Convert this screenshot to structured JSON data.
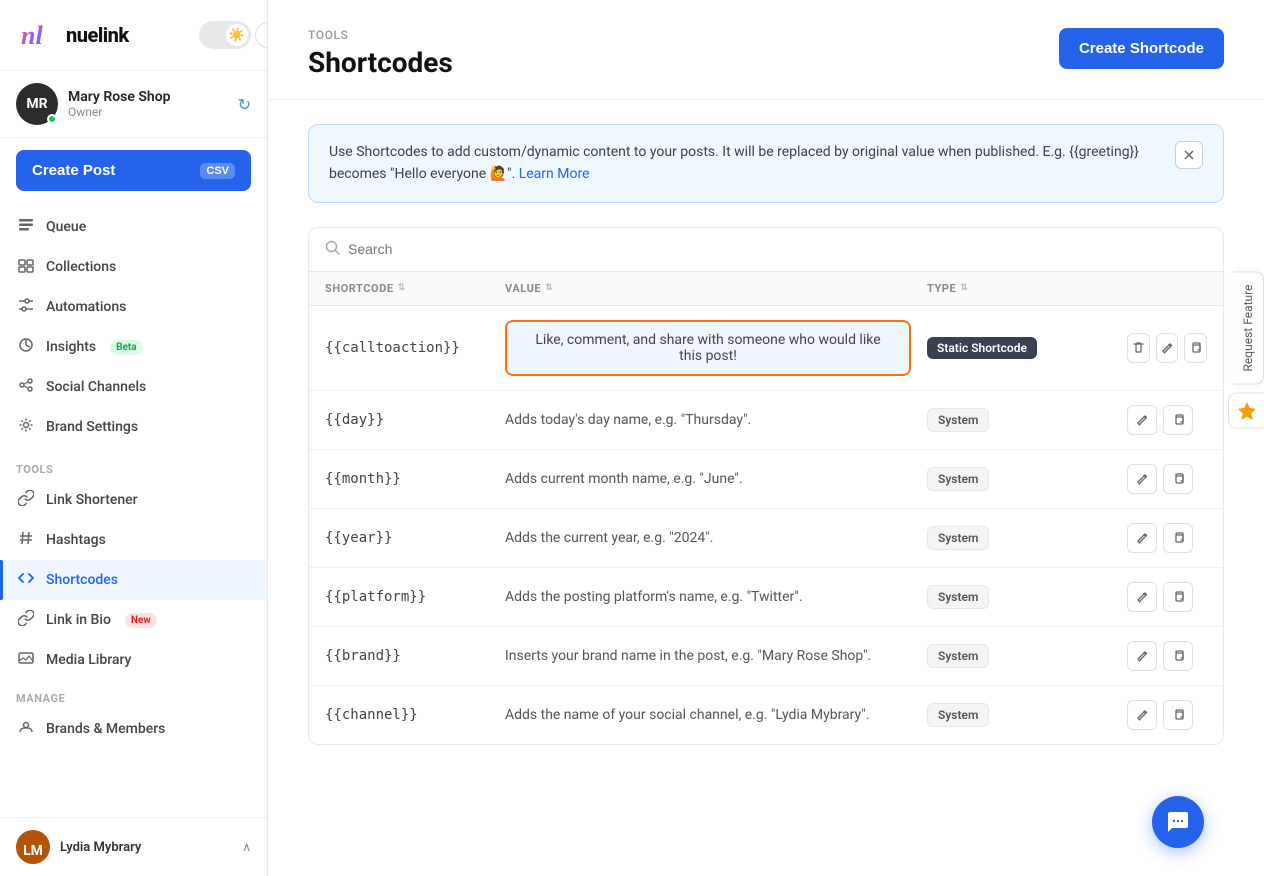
{
  "app": {
    "name": "nuelink",
    "logo_initials": "nl"
  },
  "theme": {
    "icon": "☀️",
    "mode": "light"
  },
  "account": {
    "name": "Mary Rose Shop",
    "role": "Owner",
    "initials": "MR",
    "online": true
  },
  "sidebar": {
    "create_post_label": "Create Post",
    "csv_label": "CSV",
    "nav_items": [
      {
        "id": "queue",
        "label": "Queue",
        "icon": "📅"
      },
      {
        "id": "collections",
        "label": "Collections",
        "icon": "📁"
      },
      {
        "id": "automations",
        "label": "Automations",
        "icon": "✏️"
      },
      {
        "id": "insights",
        "label": "Insights",
        "icon": "🕐",
        "badge": "Beta",
        "badge_type": "beta"
      },
      {
        "id": "social-channels",
        "label": "Social Channels",
        "icon": "🔗"
      },
      {
        "id": "brand-settings",
        "label": "Brand Settings",
        "icon": "⚙️"
      }
    ],
    "tools_label": "TOOLS",
    "tools_items": [
      {
        "id": "link-shortener",
        "label": "Link Shortener",
        "icon": "🔗"
      },
      {
        "id": "hashtags",
        "label": "Hashtags",
        "icon": "#"
      },
      {
        "id": "shortcodes",
        "label": "Shortcodes",
        "icon": "{}",
        "active": true
      },
      {
        "id": "link-in-bio",
        "label": "Link in Bio",
        "icon": "🔗",
        "badge": "New",
        "badge_type": "new"
      },
      {
        "id": "media-library",
        "label": "Media Library",
        "icon": "🖼️"
      }
    ],
    "manage_label": "MANAGE",
    "manage_items": [
      {
        "id": "brands-members",
        "label": "Brands & Members",
        "icon": "👥"
      }
    ],
    "footer_user": "Lydia Mybrary"
  },
  "page": {
    "section_label": "TOOLS",
    "title": "Shortcodes",
    "create_button_label": "Create Shortcode"
  },
  "info_banner": {
    "text": "Use Shortcodes to add custom/dynamic content to your posts. It will be replaced by original value when published. E.g. {{greeting}} becomes \"Hello everyone 🙋\". ",
    "learn_more_label": "Learn More",
    "learn_more_url": "#"
  },
  "search": {
    "placeholder": "Search"
  },
  "table": {
    "columns": [
      {
        "id": "shortcode",
        "label": "SHORTCODE"
      },
      {
        "id": "value",
        "label": "VALUE"
      },
      {
        "id": "type",
        "label": "TYPE"
      },
      {
        "id": "actions",
        "label": ""
      }
    ],
    "rows": [
      {
        "shortcode": "{{calltoaction}}",
        "value": "Like, comment, and share with someone who would like this post!",
        "type": "Static Shortcode",
        "type_class": "static",
        "highlighted": true,
        "edit_icon": "✎",
        "copy_icon": "⧉",
        "delete_icon": "🗑"
      },
      {
        "shortcode": "{{day}}",
        "value": "Adds today's day name, e.g. \"Thursday\".",
        "type": "System",
        "type_class": "system",
        "highlighted": false
      },
      {
        "shortcode": "{{month}}",
        "value": "Adds current month name, e.g. \"June\".",
        "type": "System",
        "type_class": "system",
        "highlighted": false
      },
      {
        "shortcode": "{{year}}",
        "value": "Adds the current year, e.g. \"2024\".",
        "type": "System",
        "type_class": "system",
        "highlighted": false
      },
      {
        "shortcode": "{{platform}}",
        "value": "Adds the posting platform's name, e.g. \"Twitter\".",
        "type": "System",
        "type_class": "system",
        "highlighted": false
      },
      {
        "shortcode": "{{brand}}",
        "value": "Inserts your brand name in the post, e.g. \"Mary Rose Shop\".",
        "type": "System",
        "type_class": "system",
        "highlighted": false
      },
      {
        "shortcode": "{{channel}}",
        "value": "Adds the name of your social channel, e.g. \"Lydia Mybrary\".",
        "type": "System",
        "type_class": "system",
        "highlighted": false
      }
    ]
  },
  "right_panel": {
    "request_feature_label": "Request Feature",
    "star_icon": "⭐"
  },
  "chat": {
    "icon": "💬"
  }
}
